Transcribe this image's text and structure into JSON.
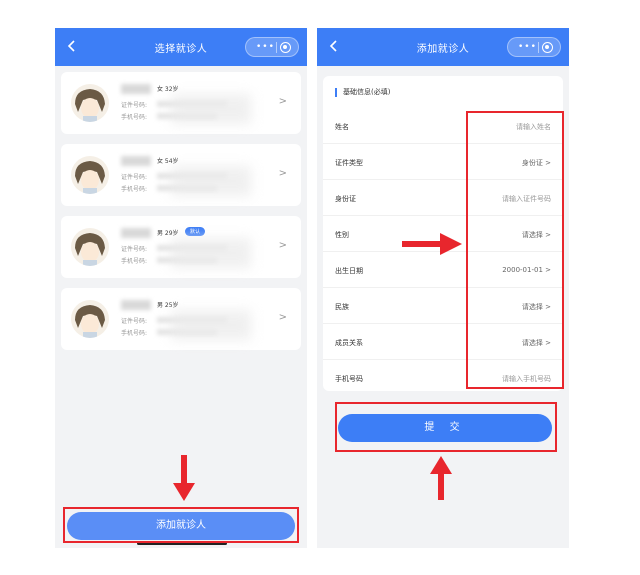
{
  "left_screen": {
    "title": "选择就诊人",
    "patients": [
      {
        "info": "女 32岁",
        "badge": "",
        "id_label": "证件号码:",
        "phone_label": "手机号码:"
      },
      {
        "info": "女 54岁",
        "badge": "",
        "id_label": "证件号码:",
        "phone_label": "手机号码:"
      },
      {
        "info": "男 29岁",
        "badge": "默认",
        "id_label": "证件号码:",
        "phone_label": "手机号码:"
      },
      {
        "info": "男 25岁",
        "badge": "",
        "id_label": "证件号码:",
        "phone_label": "手机号码:"
      }
    ],
    "add_button": "添加就诊人"
  },
  "right_screen": {
    "title": "添加就诊人",
    "section_title": "基础信息(必填)",
    "fields": [
      {
        "label": "姓名",
        "value": "请输入姓名"
      },
      {
        "label": "证件类型",
        "value": "身份证 >"
      },
      {
        "label": "身份证",
        "value": "请输入证件号码"
      },
      {
        "label": "性别",
        "value": "请选择 >"
      },
      {
        "label": "出生日期",
        "value": "2000-01-01 >"
      },
      {
        "label": "民族",
        "value": "请选择 >"
      },
      {
        "label": "成员关系",
        "value": "请选择 >"
      },
      {
        "label": "手机号码",
        "value": "请输入手机号码"
      }
    ],
    "submit_button": "提 交"
  },
  "icons": {
    "back": "back-chevron-icon",
    "more": "more-dots-icon",
    "target": "target-icon",
    "chevron": "chevron-right-icon"
  },
  "colors": {
    "primary": "#3d7ef6",
    "annotation": "#e8262d",
    "background": "#f2f3f5"
  }
}
